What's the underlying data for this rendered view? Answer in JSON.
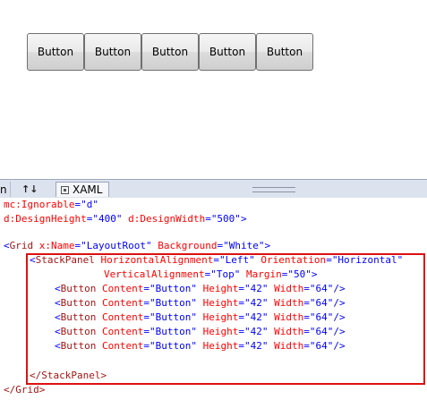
{
  "design": {
    "buttons": [
      "Button",
      "Button",
      "Button",
      "Button",
      "Button"
    ]
  },
  "tabs": {
    "left_label": "n",
    "swap_label": "↑↓",
    "xaml_label": "XAML"
  },
  "code": {
    "line1": {
      "attr": "mc:Ignorable",
      "value": "\"d\""
    },
    "line2": {
      "attr1": "d:DesignHeight",
      "value1": "\"400\"",
      "attr2": "d:DesignWidth",
      "value2": "\"500\""
    },
    "grid": {
      "open": "<",
      "tag": "Grid",
      "attr1": "x:Name",
      "value1": "\"LayoutRoot\"",
      "attr2": "Background",
      "value2": "\"White\"",
      "close": ">"
    },
    "sp": {
      "open": "<",
      "tag": "StackPanel",
      "attr1": "HorizontalAlignment",
      "value1": "\"Left\"",
      "attr2": "Orientation",
      "value2": "\"Horizontal\""
    },
    "sp2": {
      "attr1": "VerticalAlignment",
      "value1": "\"Top\"",
      "attr2": "Margin",
      "value2": "\"50\"",
      "close": ">"
    },
    "button_line": {
      "open": "<",
      "tag": "Button",
      "attr1": "Content",
      "value1": "\"Button\"",
      "attr2": "Height",
      "value2": "\"42\"",
      "attr3": "Width",
      "value3": "\"64\"",
      "close": "/>"
    },
    "sp_close": "</StackPanel>",
    "grid_close": "</Grid>"
  }
}
